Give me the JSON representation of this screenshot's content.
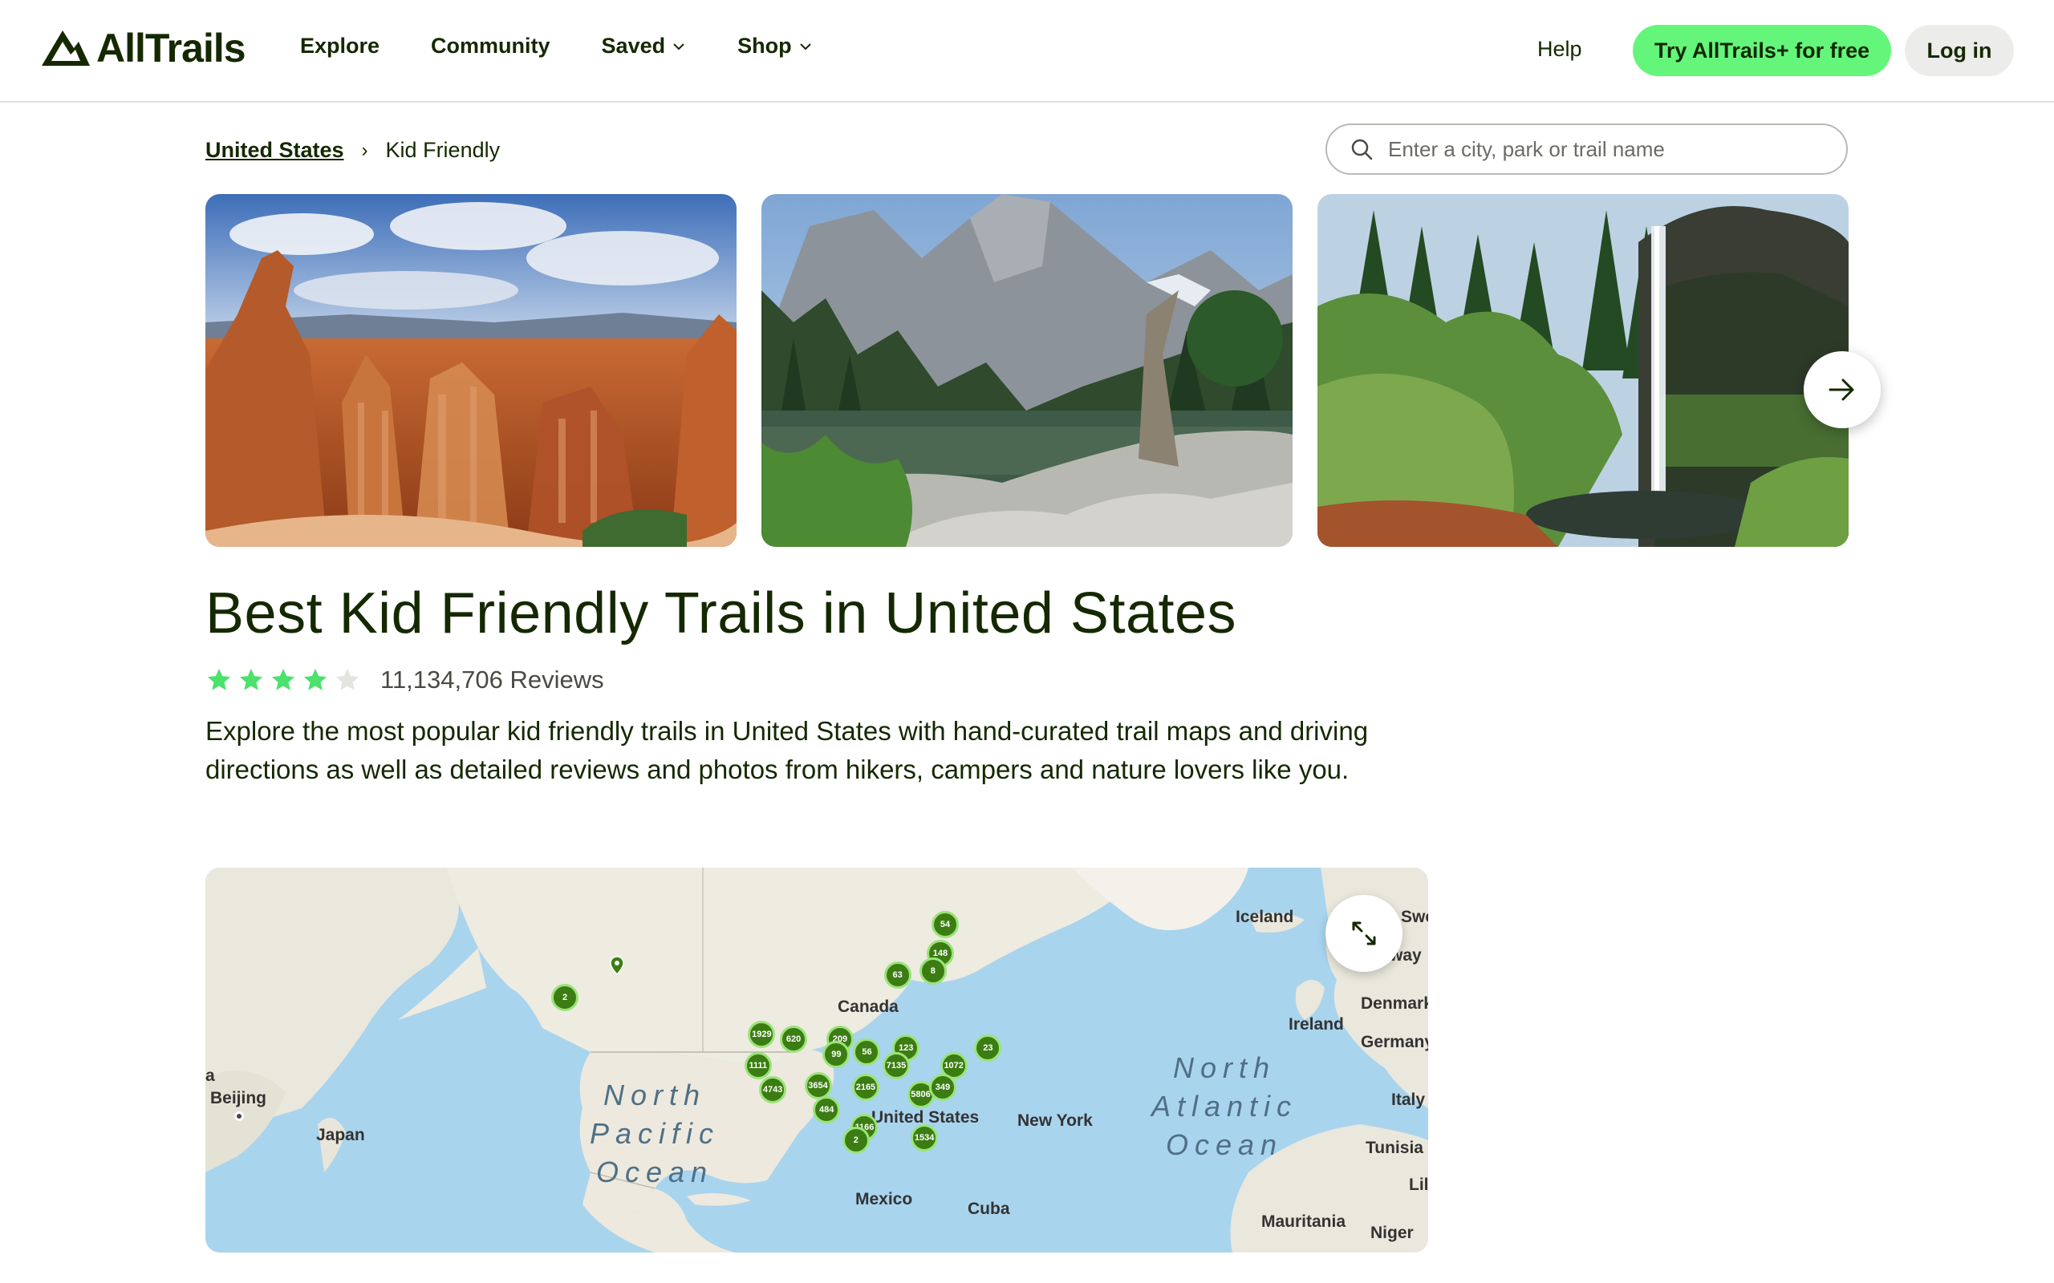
{
  "header": {
    "logo_text": "AllTrails",
    "nav": [
      {
        "label": "Explore",
        "dropdown": false
      },
      {
        "label": "Community",
        "dropdown": false
      },
      {
        "label": "Saved",
        "dropdown": true
      },
      {
        "label": "Shop",
        "dropdown": true
      }
    ],
    "help_label": "Help",
    "try_label": "Try AllTrails+ for free",
    "login_label": "Log in"
  },
  "breadcrumb": {
    "parent": "United States",
    "separator": "›",
    "current": "Kid Friendly"
  },
  "search": {
    "placeholder": "Enter a city, park or trail name"
  },
  "photos": [
    {
      "alt": "Red rock hoodoos canyon"
    },
    {
      "alt": "Alpine lake with mountain peaks"
    },
    {
      "alt": "Waterfall over cliff in forest"
    }
  ],
  "page": {
    "title": "Best Kid Friendly Trails in United States",
    "rating": 4,
    "rating_max": 5,
    "reviews": "11,134,706 Reviews",
    "description": "Explore the most popular kid friendly trails in United States with hand-curated trail maps and driving directions as well as detailed reviews and photos from hikers, campers and nature lovers like you."
  },
  "map": {
    "labels": {
      "iceland": "Iceland",
      "swe": "Swe",
      "norway": "way",
      "denmark": "Denmark",
      "ireland": "Ireland",
      "germany": "Germany",
      "italy": "Italy",
      "tunisia": "Tunisia",
      "libya": "Lil",
      "mauritania": "Mauritania",
      "niger": "Niger",
      "canada": "Canada",
      "beijing": "Beijing",
      "japan": "Japan",
      "a": "a",
      "new_york": "New York",
      "cuba": "Cuba",
      "mexico": "Mexico",
      "united_states": "United States"
    },
    "ocean_north_pacific": "North\nPacific\nOcean",
    "ocean_north_atlantic": "North\nAtlantic\nOcean",
    "clusters": [
      "54",
      "148",
      "8",
      "63",
      "2",
      "1929",
      "620",
      "209",
      "56",
      "123",
      "23",
      "99",
      "7135",
      "1072",
      "1111",
      "4743",
      "3654",
      "2165",
      "5806",
      "349",
      "484",
      "1166",
      "1534",
      "2"
    ]
  },
  "colors": {
    "brand_green": "#64f67b",
    "text_dark": "#142900",
    "cluster_green": "#3b7d12",
    "star_green": "#4be16b"
  }
}
